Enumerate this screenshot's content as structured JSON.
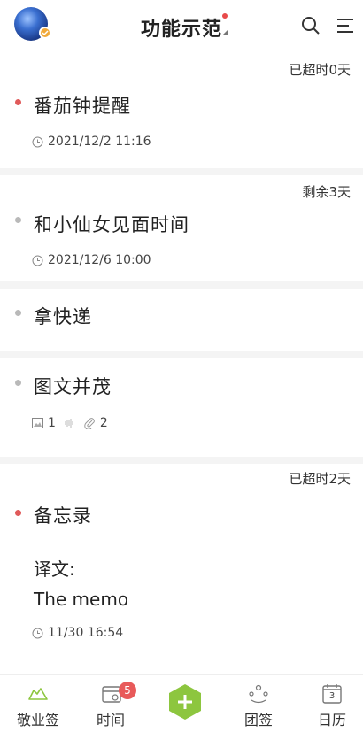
{
  "header": {
    "title": "功能示范",
    "icons": {
      "search": "search-icon",
      "menu": "menu-icon",
      "avatar": "avatar"
    }
  },
  "memos": [
    {
      "status": "已超时0天",
      "title": "番茄钟提醒",
      "time": "2021/12/2  11:16",
      "bullet": "#e05a5a"
    },
    {
      "status": "剩余3天",
      "title": "和小仙女见面时间",
      "time": "2021/12/6  10:00",
      "bullet": "#b9b9b9"
    },
    {
      "title": "拿快递",
      "bullet": "#b9b9b9"
    },
    {
      "title": "图文并茂",
      "bullet": "#b9b9b9",
      "image_count": "1",
      "attachment_count": "2"
    },
    {
      "status": "已超时2天",
      "title": "备忘录",
      "body_line1": "译文:",
      "body_line2": "The memo",
      "time": "11/30  16:54",
      "bullet": "#e05a5a"
    }
  ],
  "nav": {
    "items": [
      {
        "label": "敬业签",
        "icon": "cloud-icon"
      },
      {
        "label": "时间",
        "icon": "calendar-clock-icon",
        "badge": "5"
      },
      {
        "label": "",
        "icon": "add-icon"
      },
      {
        "label": "团签",
        "icon": "group-icon"
      },
      {
        "label": "日历",
        "icon": "calendar-icon",
        "day": "3"
      }
    ]
  },
  "colors": {
    "accent": "#8dc63f",
    "overdue": "#e05a5a",
    "badge": "#e85a5a"
  }
}
